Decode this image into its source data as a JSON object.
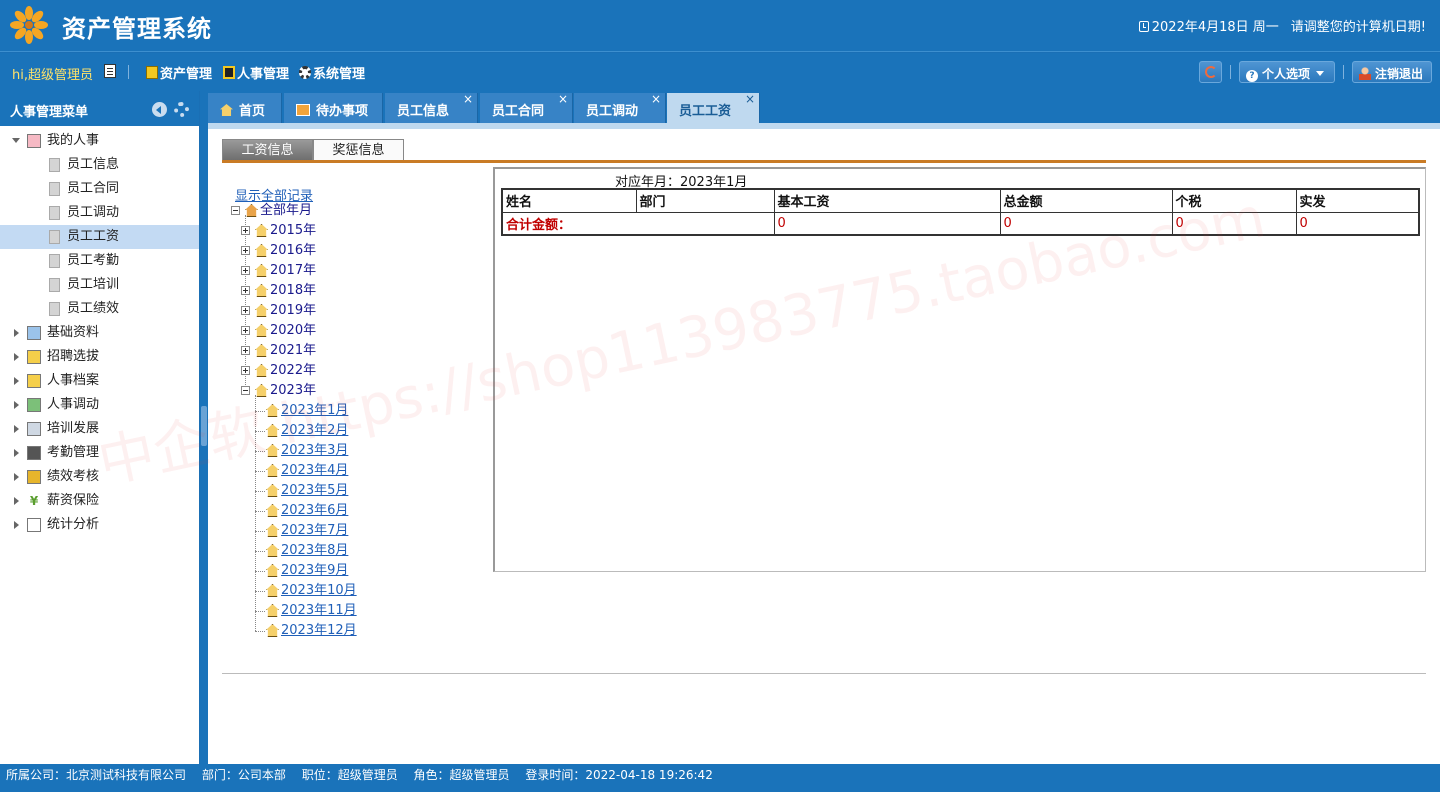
{
  "header": {
    "title": "资产管理系统",
    "date": "2022年4月18日 周一",
    "warning": "请调整您的计算机日期!"
  },
  "toolbar": {
    "greeting": "hi,超级管理员",
    "nav": [
      "资产管理",
      "人事管理",
      "系统管理"
    ],
    "personal_options": "个人选项",
    "logout": "注销退出"
  },
  "sidebar": {
    "title": "人事管理菜单",
    "groups": [
      {
        "label": "我的人事",
        "expanded": true,
        "icon": "user-card-icon",
        "children": [
          "员工信息",
          "员工合同",
          "员工调动",
          "员工工资",
          "员工考勤",
          "员工培训",
          "员工绩效"
        ]
      },
      {
        "label": "基础资料",
        "icon": "database-icon"
      },
      {
        "label": "招聘选拔",
        "icon": "megaphone-icon"
      },
      {
        "label": "人事档案",
        "icon": "folder-icon"
      },
      {
        "label": "人事调动",
        "icon": "users-icon"
      },
      {
        "label": "培训发展",
        "icon": "presentation-icon"
      },
      {
        "label": "考勤管理",
        "icon": "clock-card-icon"
      },
      {
        "label": "绩效考核",
        "icon": "signpost-icon"
      },
      {
        "label": "薪资保险",
        "icon": "yen-icon"
      },
      {
        "label": "统计分析",
        "icon": "line-chart-icon"
      }
    ],
    "selected": "员工工资"
  },
  "tabs": [
    {
      "label": "首页",
      "closable": false
    },
    {
      "label": "待办事项",
      "closable": false
    },
    {
      "label": "员工信息",
      "closable": true
    },
    {
      "label": "员工合同",
      "closable": true
    },
    {
      "label": "员工调动",
      "closable": true
    },
    {
      "label": "员工工资",
      "closable": true,
      "active": true
    }
  ],
  "subtabs": {
    "active": "工资信息",
    "other": "奖惩信息"
  },
  "year_tree": {
    "show_all": "显示全部记录",
    "root": "全部年月",
    "years": [
      "2015年",
      "2016年",
      "2017年",
      "2018年",
      "2019年",
      "2020年",
      "2021年",
      "2022年",
      "2023年"
    ],
    "months": [
      "2023年1月",
      "2023年2月",
      "2023年3月",
      "2023年4月",
      "2023年5月",
      "2023年6月",
      "2023年7月",
      "2023年8月",
      "2023年9月",
      "2023年10月",
      "2023年11月",
      "2023年12月"
    ]
  },
  "salary": {
    "period": "对应年月：2023年1月",
    "columns": [
      "姓名",
      "部门",
      "基本工资",
      "总金额",
      "个税",
      "实发"
    ],
    "total_label": "合计金额：",
    "totals": [
      "0",
      "0",
      "0",
      "0"
    ]
  },
  "watermark": "中企软  https://shop113983775.taobao.com",
  "footer": {
    "company": "所属公司：北京测试科技有限公司",
    "dept": "部门：公司本部",
    "position": "职位：超级管理员",
    "role": "角色：超级管理员",
    "login": "登录时间：2022-04-18 19:26:42"
  },
  "colors": {
    "primary": "#1a73ba",
    "accent": "#c97b25",
    "total_red": "#c00000"
  }
}
